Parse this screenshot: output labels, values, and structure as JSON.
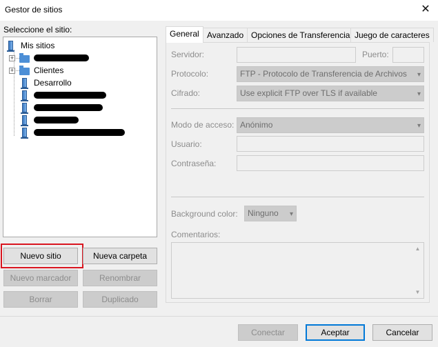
{
  "window": {
    "title": "Gestor de sitios",
    "close": "✕"
  },
  "left": {
    "select_label": "Seleccione el sitio:",
    "tree": {
      "root": "Mis sitios",
      "items": [
        {
          "label": "Clientes"
        },
        {
          "label": "Desarrollo"
        }
      ]
    },
    "buttons": {
      "new_site": "Nuevo sitio",
      "new_folder": "Nueva carpeta",
      "new_bookmark": "Nuevo marcador",
      "rename": "Renombrar",
      "delete": "Borrar",
      "duplicate": "Duplicado"
    }
  },
  "tabs": [
    "General",
    "Avanzado",
    "Opciones de Transferencia",
    "Juego de caracteres"
  ],
  "general": {
    "server_label": "Servidor:",
    "server_value": "",
    "port_label": "Puerto:",
    "port_value": "",
    "protocol_label": "Protocolo:",
    "protocol_value": "FTP - Protocolo de Transferencia de Archivos",
    "encryption_label": "Cifrado:",
    "encryption_value": "Use explicit FTP over TLS if available",
    "access_mode_label": "Modo de acceso:",
    "access_mode_value": "Anónimo",
    "user_label": "Usuario:",
    "user_value": "",
    "password_label": "Contraseña:",
    "password_value": "",
    "bg_color_label": "Background color:",
    "bg_color_value": "Ninguno",
    "comments_label": "Comentarios:",
    "comments_value": ""
  },
  "footer": {
    "connect": "Conectar",
    "accept": "Aceptar",
    "cancel": "Cancelar"
  },
  "colors": {
    "accent": "#0078d7",
    "highlight": "#d9141e"
  }
}
